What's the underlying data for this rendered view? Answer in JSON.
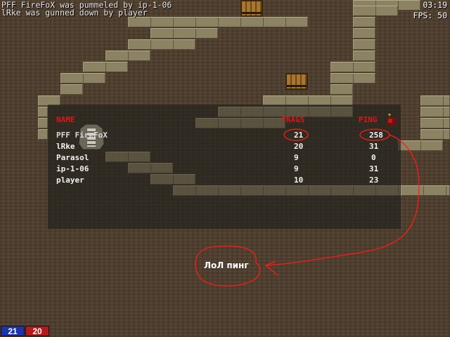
{
  "killfeed": [
    "PFF FireFoX was pummeled by ip-1-06",
    "lRke was gunned down by player"
  ],
  "hud": {
    "clock": "03:19",
    "fps": "FPS: 50"
  },
  "scoreboard": {
    "headers": {
      "name": "NAME",
      "frags": "FRAGS",
      "ping": "PING"
    },
    "rows": [
      {
        "name": "PFF FireFoX",
        "frags": "21",
        "ping": "258"
      },
      {
        "name": "lRke",
        "frags": "20",
        "ping": "31"
      },
      {
        "name": "Parasol",
        "frags": "9",
        "ping": "0"
      },
      {
        "name": "ip-1-06",
        "frags": "9",
        "ping": "31"
      },
      {
        "name": "player",
        "frags": "10",
        "ping": "23"
      }
    ]
  },
  "team_scores": {
    "blue": "21",
    "red": "20"
  },
  "annotation": "ЛоЛ пинг",
  "colors": {
    "header_red": "#e01515",
    "team_blue": "#1e34a8",
    "team_red": "#b51a1a",
    "annotation": "#ff1a1a"
  }
}
